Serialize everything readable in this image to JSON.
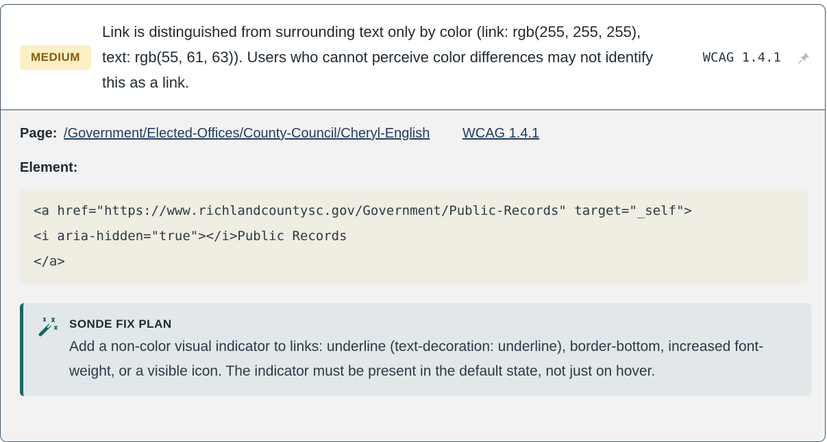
{
  "issue": {
    "severity": "MEDIUM",
    "description": "Link is distinguished from surrounding text only by color (link: rgb(255, 255, 255), text: rgb(55, 61, 63)). Users who cannot perceive color differences may not identify this as a link.",
    "wcag_tag": "WCAG 1.4.1",
    "pin_icon": "pin-icon"
  },
  "details": {
    "page_label": "Page:",
    "page_url": "/Government/Elected-Offices/County-Council/Cheryl-English",
    "wcag_link": "WCAG 1.4.1",
    "element_label": "Element:",
    "code": "<a href=\"https://www.richlandcountysc.gov/Government/Public-Records\" target=\"_self\">\n<i aria-hidden=\"true\"></i>Public Records\n</a>"
  },
  "fix_plan": {
    "icon": "magic-wand-icon",
    "title": "SONDE FIX PLAN",
    "text": "Add a non-color visual indicator to links: underline (text-decoration: underline), border-bottom, increased font-weight, or a visible icon. The indicator must be present in the default state, not just on hover."
  },
  "colors": {
    "severity_bg": "#fbefc6",
    "severity_text": "#8a5a06",
    "fix_accent": "#0f6b63",
    "code_bg": "#f0ede2"
  }
}
